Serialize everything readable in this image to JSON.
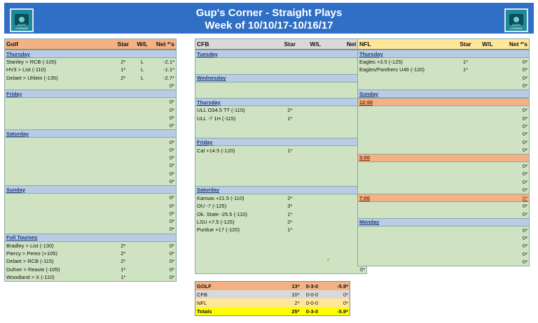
{
  "banner": {
    "title_line1": "Gup's Corner - Straight Plays",
    "title_line2": "Week of 10/10/17-10/16/17",
    "logo_left_text": "GUP'S CORNER",
    "logo_right_text": "GUP'S CORNER",
    "color": "#2f6fc5"
  },
  "columns": {
    "star": "Star",
    "wl": "W/L",
    "net": "Net *'s"
  },
  "golf": {
    "title": "Golf",
    "header_color": "#f4b183",
    "sections": [
      {
        "label": "Thursday",
        "rows": [
          {
            "name": "Stanley > RCB (-105)",
            "star": "2*",
            "wl": "L",
            "net": "-2.1*"
          },
          {
            "name": "HV3 > List (-110)",
            "star": "1*",
            "wl": "L",
            "net": "-1.1*"
          },
          {
            "name": "Delaet > Uhlein (-135)",
            "star": "2*",
            "wl": "L",
            "net": "-2.7*"
          },
          {
            "name": "",
            "star": "",
            "wl": "",
            "net": "0*"
          }
        ]
      },
      {
        "label": "Friday",
        "rows": [
          {
            "name": "",
            "star": "",
            "wl": "",
            "net": "0*"
          },
          {
            "name": "",
            "star": "",
            "wl": "",
            "net": "0*"
          },
          {
            "name": "",
            "star": "",
            "wl": "",
            "net": "0*"
          },
          {
            "name": "",
            "star": "",
            "wl": "",
            "net": "0*"
          }
        ]
      },
      {
        "label": "Saturday",
        "rows": [
          {
            "name": "",
            "star": "",
            "wl": "",
            "net": "0*"
          },
          {
            "name": "",
            "star": "",
            "wl": "",
            "net": "0*"
          },
          {
            "name": "",
            "star": "",
            "wl": "",
            "net": "0*"
          },
          {
            "name": "",
            "star": "",
            "wl": "",
            "net": "0*"
          },
          {
            "name": "",
            "star": "",
            "wl": "",
            "net": "0*"
          },
          {
            "name": "",
            "star": "",
            "wl": "",
            "net": "0*"
          }
        ]
      },
      {
        "label": "Sunday",
        "rows": [
          {
            "name": "",
            "star": "",
            "wl": "",
            "net": "0*"
          },
          {
            "name": "",
            "star": "",
            "wl": "",
            "net": "0*"
          },
          {
            "name": "",
            "star": "",
            "wl": "",
            "net": "0*"
          },
          {
            "name": "",
            "star": "",
            "wl": "",
            "net": "0*"
          },
          {
            "name": "",
            "star": "",
            "wl": "",
            "net": "0*"
          }
        ]
      },
      {
        "label": "Full Tourney",
        "rows": [
          {
            "name": "Bradley > List (-130)",
            "star": "2*",
            "wl": "",
            "net": "0*"
          },
          {
            "name": "Piercy > Perez (+105)",
            "star": "2*",
            "wl": "",
            "net": "0*"
          },
          {
            "name": "Delaet > RCB (-115)",
            "star": "2*",
            "wl": "",
            "net": "0*"
          },
          {
            "name": "Dufner > Reavie (-105)",
            "star": "1*",
            "wl": "",
            "net": "0*"
          },
          {
            "name": "Woodland > X (-110)",
            "star": "1*",
            "wl": "",
            "net": "0*"
          }
        ]
      }
    ]
  },
  "cfb": {
    "title": "CFB",
    "header_color": "#d9d9d9",
    "sections": [
      {
        "label": "Tuesday",
        "rows": [
          {
            "name": "",
            "star": "",
            "wl": "",
            "net": "0*"
          },
          {
            "name": "",
            "star": "",
            "wl": "",
            "net": "0*"
          }
        ]
      },
      {
        "label": "Wednesday",
        "rows": [
          {
            "name": "",
            "star": "",
            "wl": "",
            "net": "0*"
          },
          {
            "name": "",
            "star": "",
            "wl": "",
            "net": "0*"
          }
        ]
      },
      {
        "label": "Thursday",
        "rows": [
          {
            "name": "ULL O34.5 TT (-115)",
            "star": "2*",
            "wl": "",
            "net": "0*"
          },
          {
            "name": "ULL -7 1H (-115)",
            "star": "1*",
            "wl": "",
            "net": "0*"
          },
          {
            "name": "",
            "star": "",
            "wl": "",
            "net": "0*"
          },
          {
            "name": "",
            "star": "",
            "wl": "",
            "net": "0*"
          }
        ]
      },
      {
        "label": "Friday",
        "rows": [
          {
            "name": "Cal +14.5 (-120)",
            "star": "1*",
            "wl": "",
            "net": "0*"
          },
          {
            "name": "",
            "star": "",
            "wl": "",
            "net": "0*"
          },
          {
            "name": "",
            "star": "",
            "wl": "",
            "net": "0*"
          },
          {
            "name": "",
            "star": "",
            "wl": "",
            "net": "0*"
          },
          {
            "name": "",
            "star": "",
            "wl": "",
            "net": "0*"
          }
        ]
      },
      {
        "label": "Saturday",
        "rows": [
          {
            "name": "Kansas +21.5 (-110)",
            "star": "2*",
            "wl": "",
            "net": "0*"
          },
          {
            "name": "OU -7 (-125)",
            "star": "3*",
            "wl": "",
            "net": "0*"
          },
          {
            "name": "Ok. State -25.5 (-110)",
            "star": "1*",
            "wl": "",
            "net": "0*"
          },
          {
            "name": "LSU +7.5 (-125)",
            "star": "2*",
            "wl": "",
            "net": "0*"
          },
          {
            "name": "Purdue +17 (-120)",
            "star": "1*",
            "wl": "",
            "net": "0*"
          },
          {
            "name": "",
            "star": "",
            "wl": "",
            "net": "0*"
          },
          {
            "name": "",
            "star": "",
            "wl": "",
            "net": "0*"
          },
          {
            "name": "",
            "star": "",
            "wl": "",
            "net": "0*"
          },
          {
            "name": "",
            "star": "",
            "wl": "",
            "net": "0*"
          },
          {
            "name": "",
            "star": "",
            "wl": "",
            "net": "0*"
          }
        ]
      }
    ]
  },
  "nfl": {
    "title": "NFL",
    "header_color": "#ffe699",
    "sections": [
      {
        "label": "Thursday",
        "rows": [
          {
            "name": "Eagles +3.5 (-125)",
            "star": "1*",
            "wl": "",
            "net": "0*"
          },
          {
            "name": "Eagles/Panthers U46 (-120)",
            "star": "1*",
            "wl": "",
            "net": "0*"
          },
          {
            "name": "",
            "star": "",
            "wl": "",
            "net": "0*"
          },
          {
            "name": "",
            "star": "",
            "wl": "",
            "net": "0*"
          }
        ]
      },
      {
        "label": "Sunday",
        "rows": []
      },
      {
        "label": "12:00",
        "orange": true,
        "rows": [
          {
            "name": "",
            "star": "",
            "wl": "",
            "net": "0*"
          },
          {
            "name": "",
            "star": "",
            "wl": "",
            "net": "0*"
          },
          {
            "name": "",
            "star": "",
            "wl": "",
            "net": "0*"
          },
          {
            "name": "",
            "star": "",
            "wl": "",
            "net": "0*"
          },
          {
            "name": "",
            "star": "",
            "wl": "",
            "net": "0*"
          },
          {
            "name": "",
            "star": "",
            "wl": "",
            "net": "0*"
          }
        ]
      },
      {
        "label": "3:00",
        "orange": true,
        "rows": [
          {
            "name": "",
            "star": "",
            "wl": "",
            "net": "0*"
          },
          {
            "name": "",
            "star": "",
            "wl": "",
            "net": "0*"
          },
          {
            "name": "",
            "star": "",
            "wl": "",
            "net": "0*"
          },
          {
            "name": "",
            "star": "",
            "wl": "",
            "net": "0*"
          }
        ]
      },
      {
        "label": "7:00",
        "orange": true,
        "inline_net": "0*",
        "rows": [
          {
            "name": "",
            "star": "",
            "wl": "",
            "net": "0*"
          },
          {
            "name": "",
            "star": "",
            "wl": "",
            "net": "0*"
          }
        ]
      },
      {
        "label": "Monday",
        "rows": [
          {
            "name": "",
            "star": "",
            "wl": "",
            "net": "0*"
          },
          {
            "name": "",
            "star": "",
            "wl": "",
            "net": "0*"
          },
          {
            "name": "",
            "star": "",
            "wl": "",
            "net": "0*"
          },
          {
            "name": "",
            "star": "",
            "wl": "",
            "net": "0*"
          },
          {
            "name": "",
            "star": "",
            "wl": "",
            "net": "0*"
          }
        ]
      }
    ]
  },
  "summary": [
    {
      "label": "GOLF",
      "star": "13*",
      "wl": "0-3-0",
      "net": "-5.9*",
      "cls": "golf"
    },
    {
      "label": "CFB",
      "star": "10*",
      "wl": "0-0-0",
      "net": "0*",
      "cls": "cfb"
    },
    {
      "label": "NFL",
      "star": "2*",
      "wl": "0-0-0",
      "net": "0*",
      "cls": "nfl"
    },
    {
      "label": "Totals",
      "star": "25*",
      "wl": "0-3-0",
      "net": "-5.9*",
      "cls": "tot"
    }
  ]
}
